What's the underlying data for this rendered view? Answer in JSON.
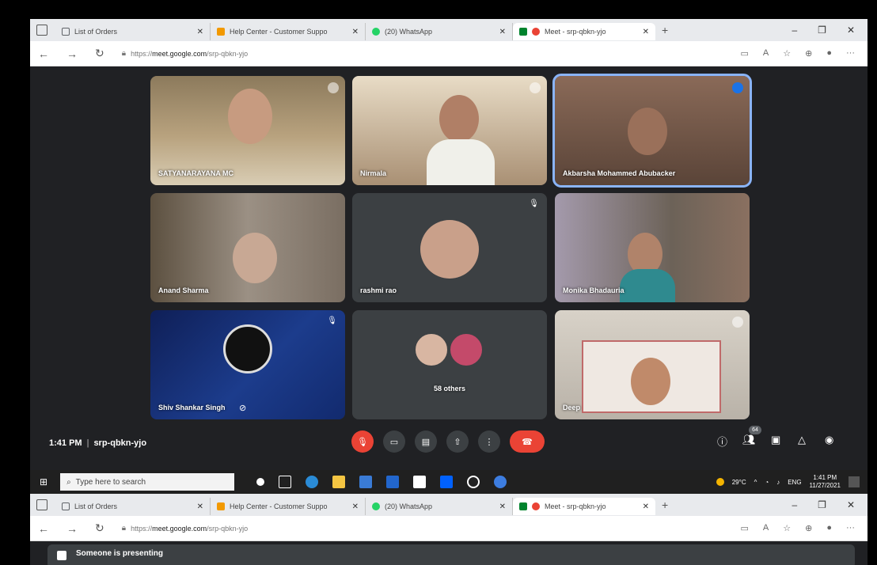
{
  "browser": {
    "tabs": [
      {
        "label": "List of Orders",
        "favicon_color": "#5f6368"
      },
      {
        "label": "Help Center - Customer Suppo",
        "favicon_color": "#f29900"
      },
      {
        "label": "(20) WhatsApp",
        "favicon_color": "#25d366"
      },
      {
        "label": "Meet - srp-qbkn-yjo",
        "favicon_color": "#ea4335"
      }
    ],
    "url_prefix": "https://",
    "url_host": "meet.google.com",
    "url_path": "/srp-qbkn-yjo"
  },
  "meet": {
    "participants": [
      {
        "name": "SATYANARAYANA MC",
        "bg": "#9c8a6a"
      },
      {
        "name": "Nirmala",
        "bg": "#b8a78a"
      },
      {
        "name": "Akbarsha Mohammed Abubacker",
        "bg": "#7d6a58"
      },
      {
        "name": "Anand Sharma",
        "bg": "#6a6258"
      },
      {
        "name": "rashmi rao",
        "bg": "#3c4043"
      },
      {
        "name": "Monika Bhadauria",
        "bg": "#8b8a94"
      },
      {
        "name": "Shiv Shankar Singh",
        "bg": "#1b2c66"
      },
      {
        "name": "58 others",
        "bg": "#3c4043"
      },
      {
        "name": "Deep",
        "bg": "#c7c0b4"
      }
    ],
    "time": "1:41 PM",
    "meeting_code": "srp-qbkn-yjo",
    "participant_count": "64"
  },
  "taskbar": {
    "search_placeholder": "Type here to search",
    "temperature": "29°C",
    "language": "ENG",
    "clock_time": "1:41 PM",
    "clock_date": "11/27/2021"
  },
  "banner": {
    "text": "Someone is presenting"
  }
}
